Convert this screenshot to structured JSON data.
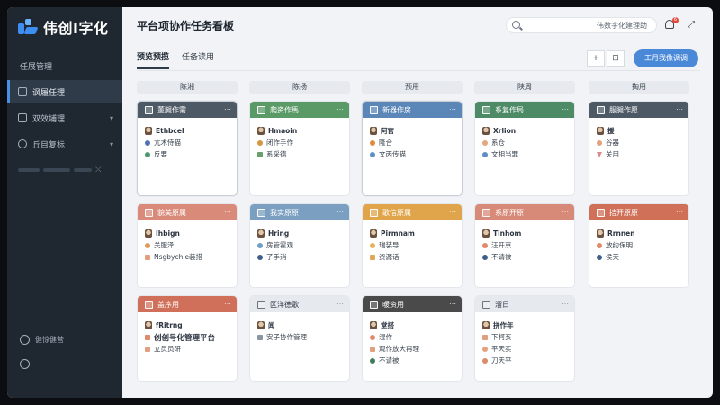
{
  "app": {
    "logo_text": "伟创I字化",
    "page_title": "平台项协作任务看板"
  },
  "sidebar": {
    "items": [
      {
        "label": "任展管理",
        "active": false
      },
      {
        "label": "讽履任理",
        "active": true
      },
      {
        "label": "双效埔理",
        "active": false
      },
      {
        "label": "丘目复标",
        "active": false
      }
    ],
    "bottom": [
      {
        "label": "健惊健营",
        "icon": "person-icon"
      },
      {
        "label": "",
        "icon": "settings-icon"
      }
    ]
  },
  "topbar": {
    "search_text": "伟数字化建理助",
    "notification_count": "6"
  },
  "tabs": [
    {
      "label": "预览预揽",
      "active": true
    },
    {
      "label": "任备读用",
      "active": false
    }
  ],
  "toolbar": {
    "add_label": "+",
    "view_label": "⊡",
    "primary_label": "工月我像调调"
  },
  "columns": [
    {
      "title": "陈湘"
    },
    {
      "title": "陈扬"
    },
    {
      "title": "预用"
    },
    {
      "title": "陕周"
    },
    {
      "title": "掏用"
    }
  ],
  "cards": [
    {
      "band": "董腿作需",
      "band_color": "#4d5965",
      "rows": [
        [
          "avatar",
          "Ethbcel"
        ],
        [
          "dot:#5470b8",
          "亢术侍猫"
        ],
        [
          "dot:#4e9a6e",
          "反要"
        ]
      ]
    },
    {
      "band": "爬资作馬",
      "band_color": "#5a9a66",
      "rows": [
        [
          "avatar",
          "Hmaoin"
        ],
        [
          "dot:#d3983d",
          "闭作手作"
        ],
        [
          "sq:#6aa070",
          "系采德"
        ]
      ]
    },
    {
      "band": "新器作房",
      "band_color": "#5a86b8",
      "rows": [
        [
          "avatar",
          "阿官"
        ],
        [
          "dot:#e08a3c",
          "隆合"
        ],
        [
          "dot:#5b8fc8",
          "文丙传猫"
        ]
      ]
    },
    {
      "band": "系复作局",
      "band_color": "#4d8a66",
      "rows": [
        [
          "avatar",
          "Xrlion"
        ],
        [
          "dot:#e6a77a",
          "系仓"
        ],
        [
          "dot:#5b8fc8",
          "文相当罪"
        ]
      ]
    },
    {
      "band": "服腿作愿",
      "band_color": "#4d5965",
      "rows": [
        [
          "avatar",
          "援"
        ],
        [
          "dot:#e6a07a",
          "谷器"
        ],
        [
          "tri:#d98b8b",
          "关用"
        ]
      ]
    },
    {
      "band": "貌美原属",
      "band_color": "#d98a78",
      "rows": [
        [
          "avatar",
          "Ihbign"
        ],
        [
          "dot:#e09a5a",
          "关服泽"
        ],
        [
          "sq:#e0a080",
          "Nsgbychie装措"
        ]
      ]
    },
    {
      "band": "我实原原",
      "band_color": "#7a9fc0",
      "rows": [
        [
          "avatar",
          "Hring"
        ],
        [
          "dot:#6fa0c8",
          "房管霍观"
        ],
        [
          "dot:#3e5f8a",
          "了手消"
        ]
      ]
    },
    {
      "band": "歌信原属",
      "band_color": "#e0a54a",
      "rows": [
        [
          "avatar",
          "Pirmnam"
        ],
        [
          "dot:#e6b25a",
          "瑞装导"
        ],
        [
          "sq:#e0a85a",
          "资源话"
        ]
      ]
    },
    {
      "band": "系原开原",
      "band_color": "#d88a78",
      "rows": [
        [
          "avatar",
          "Tinhom"
        ],
        [
          "dot:#e08a6a",
          "汪开京"
        ],
        [
          "dot:#3e5f8a",
          "不请被"
        ]
      ]
    },
    {
      "band": "拮开原原",
      "band_color": "#d07058",
      "rows": [
        [
          "avatar",
          "Rrnnen"
        ],
        [
          "dot:#e08a6a",
          "放约保明"
        ],
        [
          "dot:#3e5f8a",
          "侯天"
        ]
      ]
    },
    {
      "band": "盖序用",
      "band_color": "#d0705a",
      "rows": [
        [
          "avatar",
          "fRitrng"
        ],
        [
          "big",
          "创创号化管理平台"
        ],
        [
          "sq:#e0a080",
          "立员员研"
        ]
      ]
    },
    {
      "band": "区洋德歌",
      "band_color": "#e6e9ee",
      "dark": true,
      "rows": [
        [
          "avatar",
          "闻"
        ],
        [
          "sq:#8a96a3",
          "安子协作管理"
        ]
      ]
    },
    {
      "band": "暖资用",
      "band_color": "#4a4a4a",
      "rows": [
        [
          "avatar",
          "堂搭"
        ],
        [
          "dot:#e08a6a",
          "湿作"
        ],
        [
          "sq:#e0a080",
          "观作放大再理"
        ],
        [
          "dot:#3e7f56",
          "不请被"
        ]
      ]
    },
    {
      "band": "溜日",
      "band_color": "#e6e9ee",
      "dark": true,
      "rows": [
        [
          "avatar",
          "拼作年"
        ],
        [
          "sq:#e0a080",
          "下柯亥"
        ],
        [
          "dot:#e6a07a",
          "平天实"
        ],
        [
          "dot:#d98b6a",
          "刀天平"
        ]
      ]
    }
  ]
}
